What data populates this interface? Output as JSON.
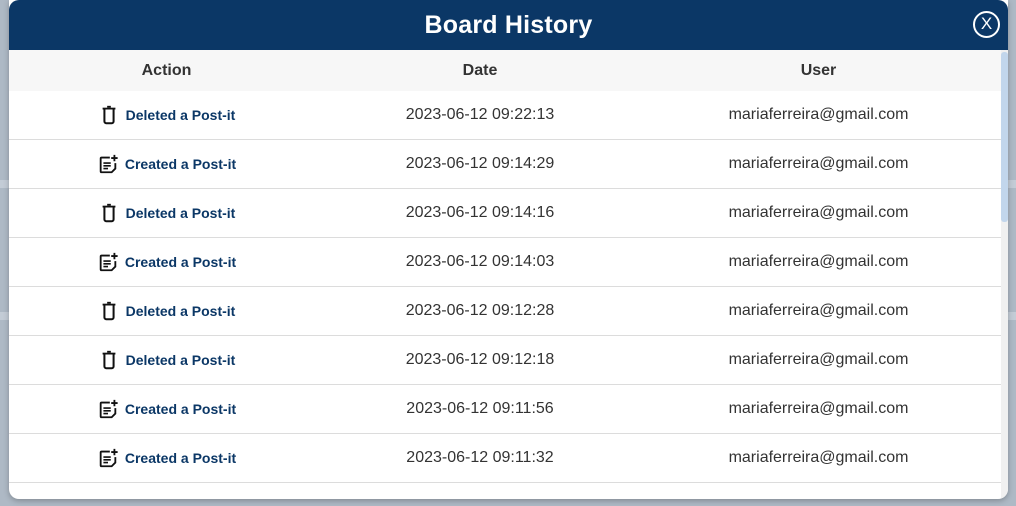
{
  "modal": {
    "title": "Board History",
    "close_label": "X"
  },
  "table": {
    "headers": {
      "action": "Action",
      "date": "Date",
      "user": "User"
    },
    "rows": [
      {
        "icon": "trash-icon",
        "action": "Deleted a Post-it",
        "date": "2023-06-12 09:22:13",
        "user": "mariaferreira@gmail.com"
      },
      {
        "icon": "note-add-icon",
        "action": "Created a Post-it",
        "date": "2023-06-12 09:14:29",
        "user": "mariaferreira@gmail.com"
      },
      {
        "icon": "trash-icon",
        "action": "Deleted a Post-it",
        "date": "2023-06-12 09:14:16",
        "user": "mariaferreira@gmail.com"
      },
      {
        "icon": "note-add-icon",
        "action": "Created a Post-it",
        "date": "2023-06-12 09:14:03",
        "user": "mariaferreira@gmail.com"
      },
      {
        "icon": "trash-icon",
        "action": "Deleted a Post-it",
        "date": "2023-06-12 09:12:28",
        "user": "mariaferreira@gmail.com"
      },
      {
        "icon": "trash-icon",
        "action": "Deleted a Post-it",
        "date": "2023-06-12 09:12:18",
        "user": "mariaferreira@gmail.com"
      },
      {
        "icon": "note-add-icon",
        "action": "Created a Post-it",
        "date": "2023-06-12 09:11:56",
        "user": "mariaferreira@gmail.com"
      },
      {
        "icon": "note-add-icon",
        "action": "Created a Post-it",
        "date": "2023-06-12 09:11:32",
        "user": "mariaferreira@gmail.com"
      }
    ]
  },
  "colors": {
    "header_bg": "#0b3766",
    "action_text": "#0b3766",
    "table_header_bg": "#f7f7f7"
  }
}
